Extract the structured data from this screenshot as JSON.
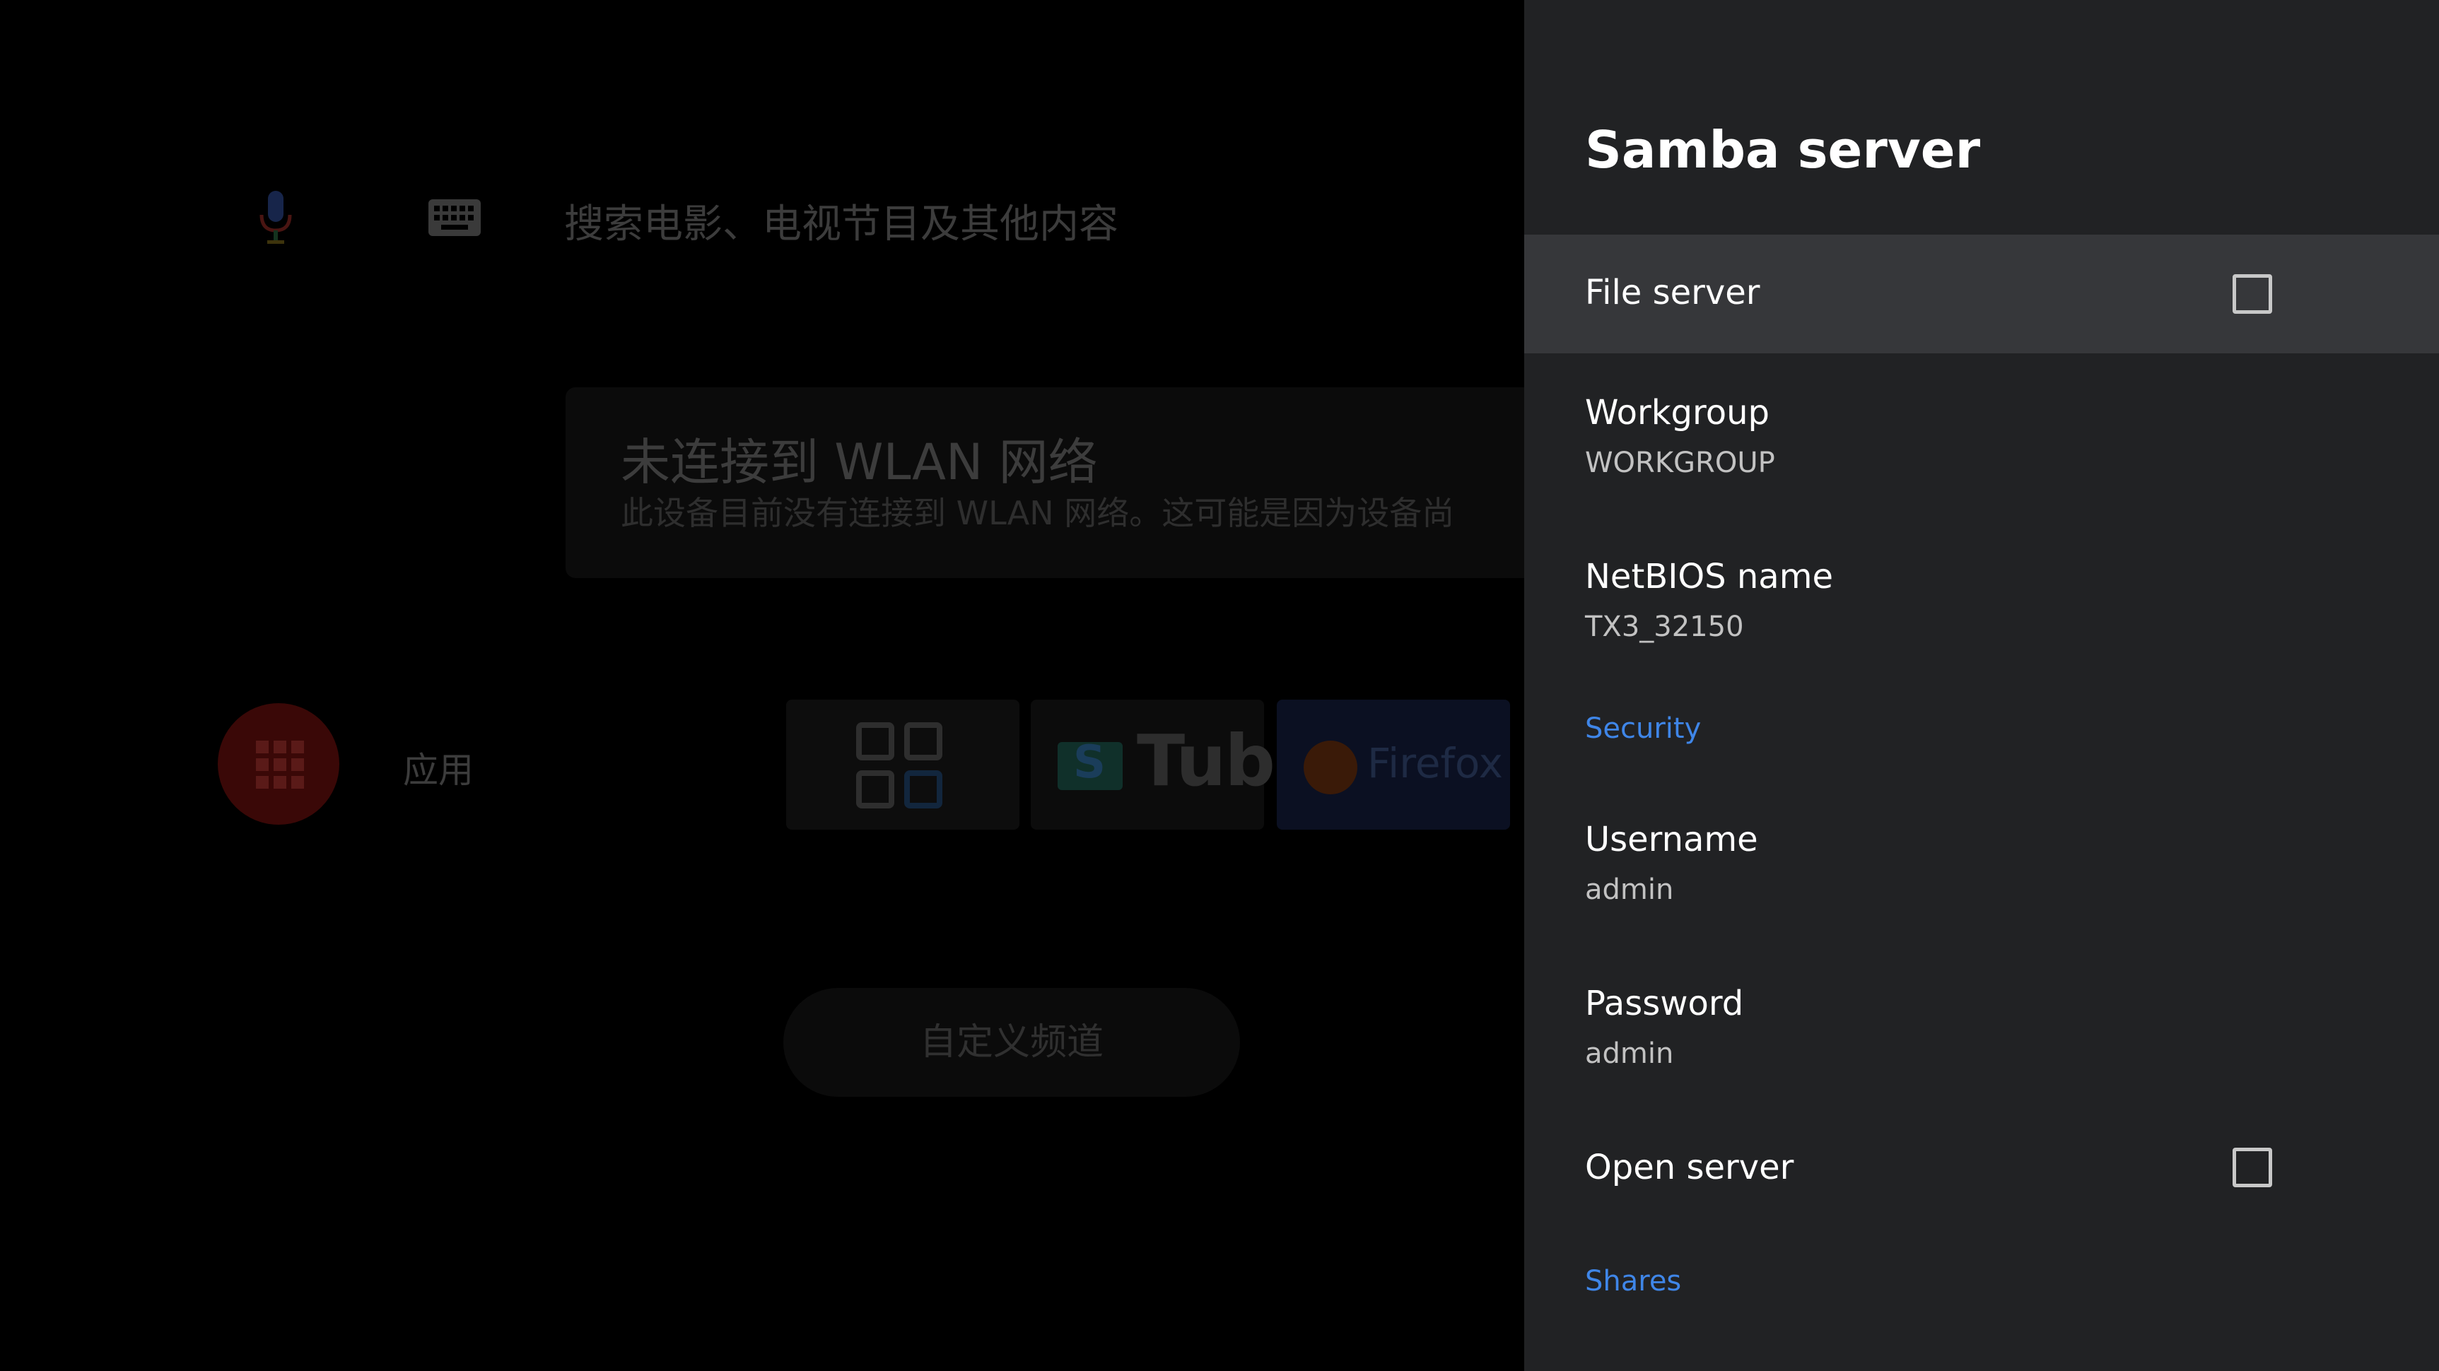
{
  "background": {
    "search_hint": "搜索电影、电视节目及其他内容",
    "wifi_title": "未连接到 WLAN 网络",
    "wifi_desc": "此设备目前没有连接到 WLAN 网络。这可能是因为设备尚",
    "apps_label": "应用",
    "tiles": {
      "youtube_text": "Tube",
      "youtube_s": "S",
      "firefox_text": "Firefox"
    },
    "channel_button": "自定义频道"
  },
  "panel": {
    "title": "Samba server",
    "file_server": {
      "label": "File server",
      "checked": false
    },
    "workgroup": {
      "label": "Workgroup",
      "value": "WORKGROUP"
    },
    "netbios": {
      "label": "NetBIOS name",
      "value": "TX3_32150"
    },
    "security_header": "Security",
    "username": {
      "label": "Username",
      "value": "admin"
    },
    "password": {
      "label": "Password",
      "value": "admin"
    },
    "open_server": {
      "label": "Open server",
      "checked": false
    },
    "shares_header": "Shares"
  },
  "colors": {
    "panel_bg": "#212224",
    "focused_row": "#36373a",
    "section_accent": "#3f86e8",
    "apps_red": "#3a0807"
  },
  "icons": {
    "mic": "microphone-icon",
    "keyboard": "keyboard-icon",
    "apps": "apps-grid-icon",
    "checkbox": "checkbox-empty-icon"
  }
}
